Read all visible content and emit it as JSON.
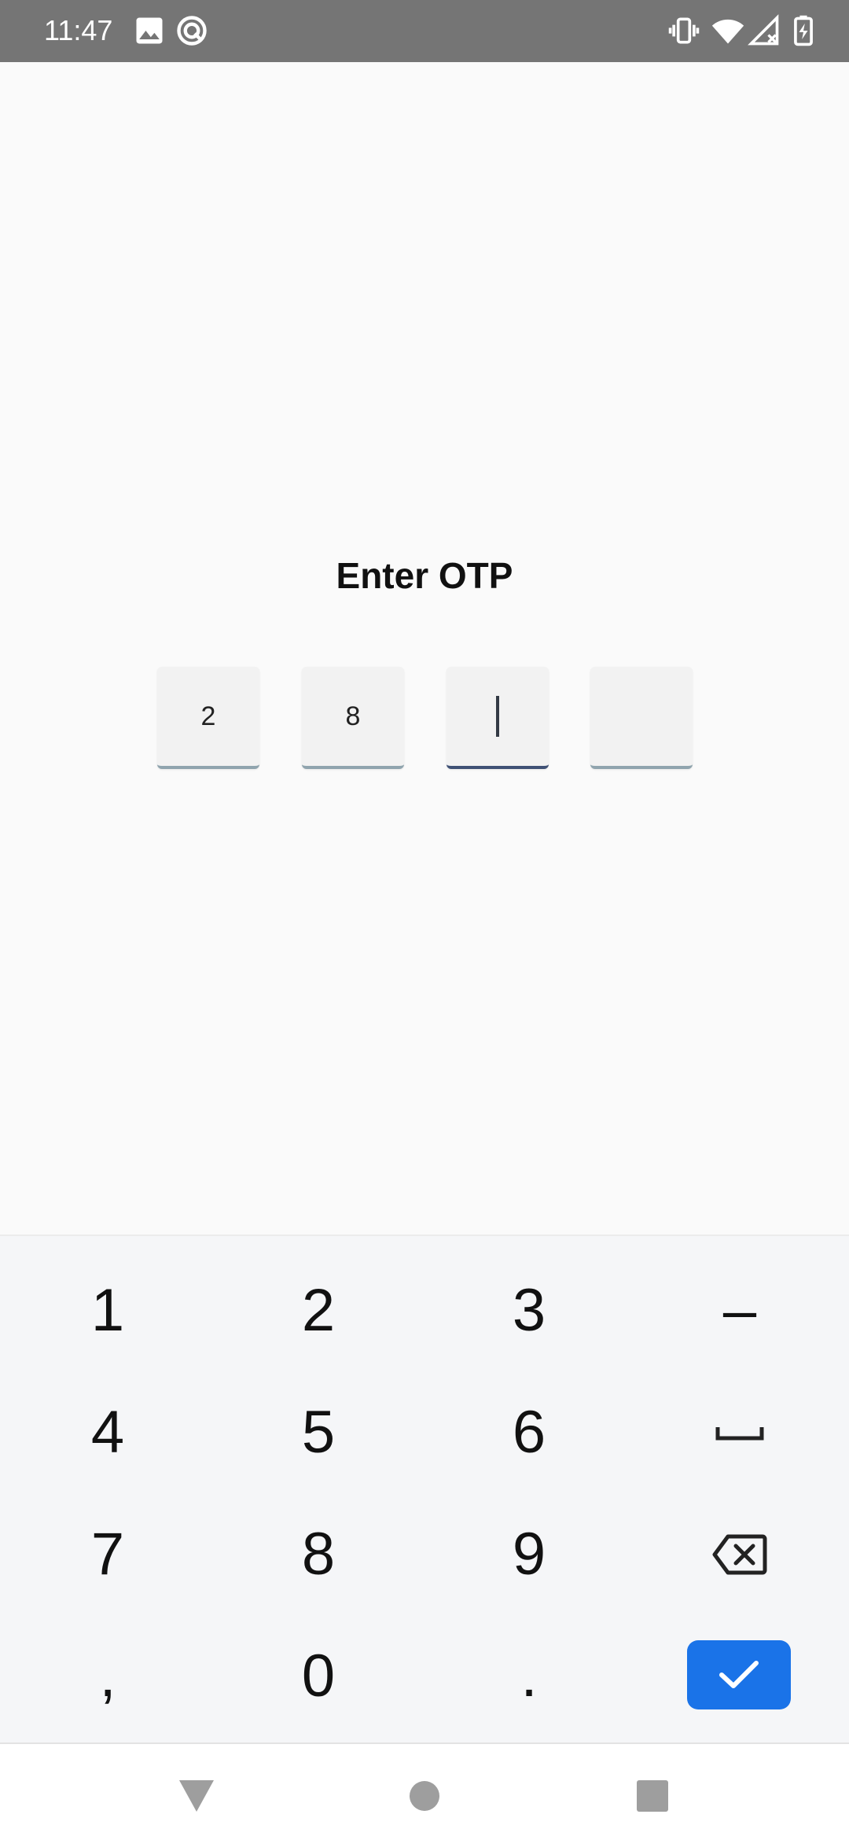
{
  "status_bar": {
    "time": "11:47",
    "icons_left": [
      "image-icon",
      "sync-circle-icon"
    ],
    "icons_right": [
      "vibrate-icon",
      "wifi-icon",
      "signal-off-icon",
      "battery-charging-icon"
    ],
    "background": "#757575"
  },
  "otp": {
    "title": "Enter OTP",
    "digits": [
      "2",
      "8",
      "",
      ""
    ],
    "active_index": 2
  },
  "keyboard": {
    "rows": [
      [
        "1",
        "2",
        "3",
        "–"
      ],
      [
        "4",
        "5",
        "6",
        "space"
      ],
      [
        "7",
        "8",
        "9",
        "backspace"
      ],
      [
        ",",
        "0",
        ".",
        "confirm"
      ]
    ],
    "confirm_color": "#1a73e8"
  },
  "nav_bar": {
    "buttons": [
      "back-icon",
      "home-icon",
      "recents-icon"
    ]
  }
}
